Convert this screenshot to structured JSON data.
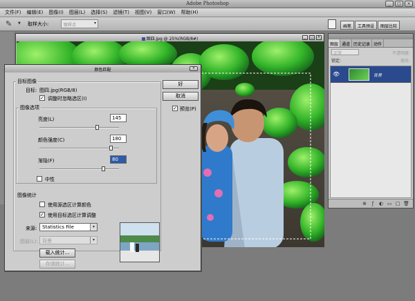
{
  "app": {
    "title": "Adobe Photoshop"
  },
  "window_buttons": [
    "_",
    "□",
    "×"
  ],
  "menu": [
    "文件(F)",
    "编辑(E)",
    "图像(I)",
    "图层(L)",
    "选择(S)",
    "滤镜(T)",
    "视图(V)",
    "窗口(W)",
    "帮助(H)"
  ],
  "options": {
    "tool_icon": "✎",
    "sample_label": "取样大小:",
    "sample_value": "取样点",
    "panel_tabs": [
      "画笔",
      "工具预设",
      "图层比较"
    ]
  },
  "document": {
    "title": "图四.jpg @ 25%(RGB/8#)",
    "buttons": [
      "_",
      "□",
      "×"
    ]
  },
  "layers": {
    "tabs": [
      "图层",
      "通道",
      "历史记录",
      "动作"
    ],
    "blend_mode": "正常",
    "opacity_label": "不透明度:",
    "lock_label": "锁定:",
    "fill_label": "填充:",
    "layer_name": "背景",
    "eye_icon": "👁",
    "footer_icons": [
      "⊗",
      "ƒ",
      "◐",
      "▭",
      "□",
      "🗑"
    ]
  },
  "dialog": {
    "title": "颜色匹配",
    "close": "×",
    "target_group": "目标图像",
    "target_label": "目标:",
    "target_value": "图四.jpg(RGB/8)",
    "ignore_selection": "调整时忽略选区(I)",
    "options_group": "图像选项",
    "luminance_label": "亮度(L)",
    "luminance_value": "145",
    "luminance": 145,
    "luminance_range": [
      1,
      200
    ],
    "color_intensity_label": "颜色强度(C)",
    "color_intensity_value": "180",
    "color_intensity": 180,
    "color_intensity_range": [
      1,
      200
    ],
    "fade_label": "渐隐(F)",
    "fade_value": "80",
    "fade": 80,
    "fade_range": [
      0,
      100
    ],
    "neutralize_label": "中性",
    "stats_group": "图像统计",
    "use_source_selection": "使用源选区计算颜色",
    "use_target_selection": "使用目标选区计算调整",
    "source_label": "来源:",
    "source_value": "Statistics File",
    "layer_label": "图层(L):",
    "layer_value": "背景",
    "load_stats": "载入统计...",
    "save_stats": "存储统计...",
    "ok": "好",
    "cancel": "取消",
    "preview_label": "预览(P)",
    "check": "✓"
  }
}
